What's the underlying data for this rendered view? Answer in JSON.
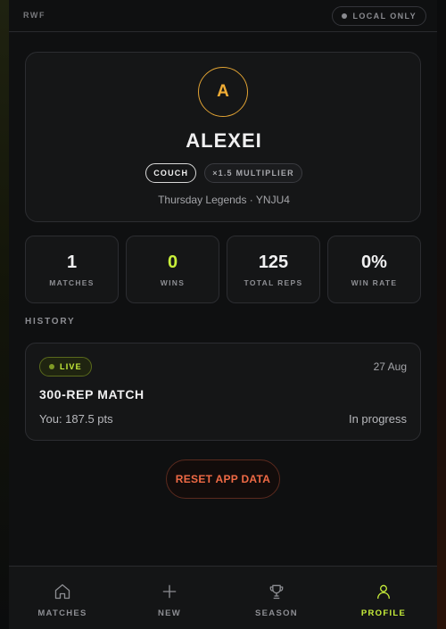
{
  "header": {
    "brand": "RWF",
    "storage_badge": "LOCAL ONLY"
  },
  "profile": {
    "avatar_initial": "A",
    "name": "ALEXEI",
    "role_tag": "COUCH",
    "multiplier_tag": "×1.5 MULTIPLIER",
    "group_line": "Thursday Legends · YNJU4"
  },
  "stats": [
    {
      "value": "1",
      "label": "MATCHES"
    },
    {
      "value": "0",
      "label": "WINS"
    },
    {
      "value": "125",
      "label": "TOTAL REPS"
    },
    {
      "value": "0%",
      "label": "WIN RATE"
    }
  ],
  "history": {
    "title": "HISTORY",
    "items": [
      {
        "status_badge": "LIVE",
        "date": "27 Aug",
        "title": "300-REP MATCH",
        "points": "You: 187.5 pts",
        "status_text": "In progress"
      }
    ]
  },
  "actions": {
    "reset_label": "RESET APP DATA"
  },
  "nav": {
    "items": [
      {
        "label": "MATCHES",
        "icon": "home-icon"
      },
      {
        "label": "NEW",
        "icon": "plus-icon"
      },
      {
        "label": "SEASON",
        "icon": "trophy-icon"
      },
      {
        "label": "PROFILE",
        "icon": "user-icon",
        "active": true
      }
    ]
  },
  "colors": {
    "accent": "#c8ef3a",
    "avatar_ring": "#e0a233",
    "danger": "#ef6a45",
    "background": "#0f1011",
    "card": "#151617"
  }
}
